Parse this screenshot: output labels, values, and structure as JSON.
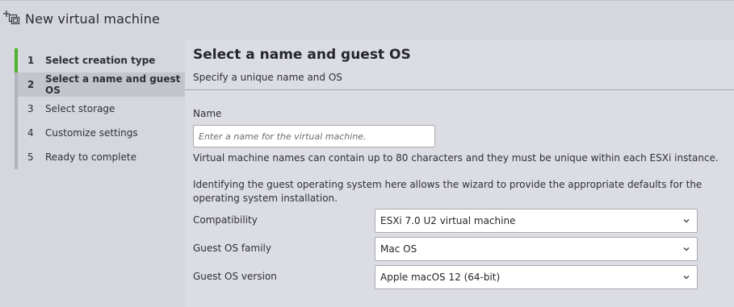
{
  "window": {
    "title": "New virtual machine",
    "title_icon": "new-vm-icon"
  },
  "steps": [
    {
      "number": "1",
      "label": "Select creation type",
      "state": "done"
    },
    {
      "number": "2",
      "label": "Select a name and guest OS",
      "state": "active"
    },
    {
      "number": "3",
      "label": "Select storage",
      "state": "pending"
    },
    {
      "number": "4",
      "label": "Customize settings",
      "state": "pending"
    },
    {
      "number": "5",
      "label": "Ready to complete",
      "state": "pending"
    }
  ],
  "main": {
    "title": "Select a name and guest OS",
    "subtitle": "Specify a unique name and OS",
    "name_label": "Name",
    "name_value": "",
    "name_placeholder": "Enter a name for the virtual machine.",
    "name_help": "Virtual machine names can contain up to 80 characters and they must be unique within each ESXi instance.",
    "guest_help": "Identifying the guest operating system here allows the wizard to provide the appropriate defaults for the operating system installation.",
    "fields": [
      {
        "label": "Compatibility",
        "value": "ESXi 7.0 U2 virtual machine"
      },
      {
        "label": "Guest OS family",
        "value": "Mac OS"
      },
      {
        "label": "Guest OS version",
        "value": "Apple macOS 12 (64-bit)"
      }
    ]
  },
  "colors": {
    "background": "#d6d7de",
    "completed_step_accent": "#4fb22d",
    "active_step_bg": "#c3c4cc"
  }
}
